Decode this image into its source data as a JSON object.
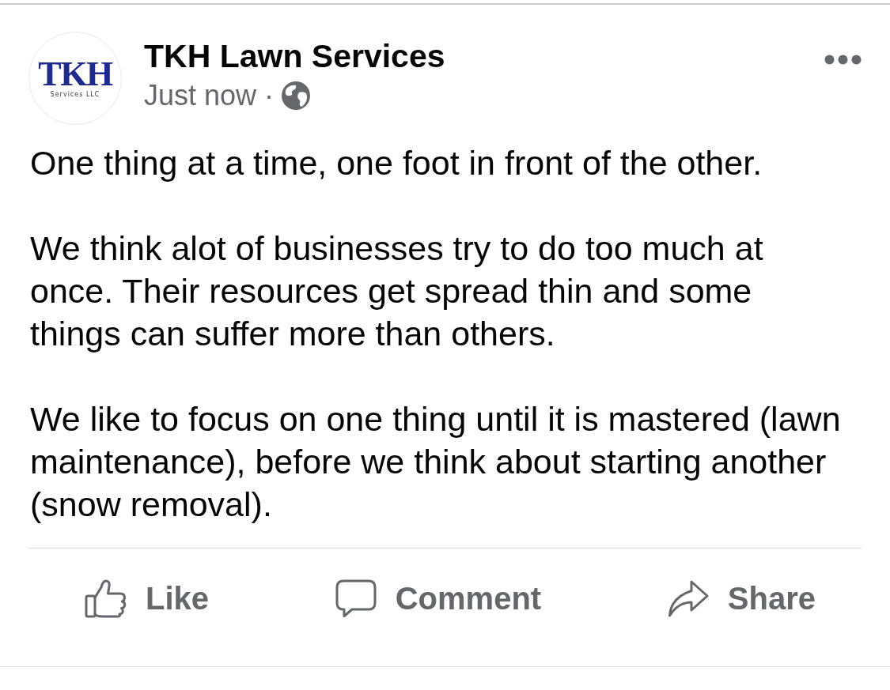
{
  "post": {
    "page": {
      "logo": {
        "wordmark": "TKH",
        "tagline": "Services LLC"
      },
      "name": "TKH Lawn Services"
    },
    "meta": {
      "time": "Just now",
      "separator": "·"
    },
    "paragraphs": [
      "One thing at a time, one foot in front of the other.",
      "We think alot of businesses try to do too much at once. Their resources get spread thin and some things can suffer more than others.",
      "We like to focus on one thing until it is mastered (lawn maintenance), before we think about starting another (snow removal)."
    ],
    "actions": [
      {
        "kind": "like",
        "label": "Like"
      },
      {
        "kind": "comment",
        "label": "Comment"
      },
      {
        "kind": "share",
        "label": "Share"
      }
    ]
  }
}
